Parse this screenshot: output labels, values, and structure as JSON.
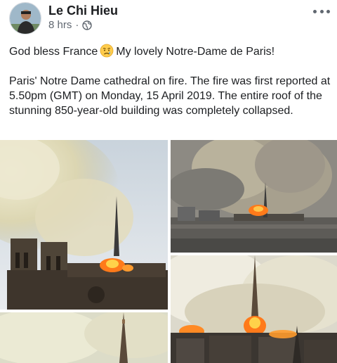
{
  "post": {
    "author": "Le Chi Hieu",
    "time": "8 hrs",
    "separator": "·",
    "privacy_icon": "globe-icon",
    "options_icon": "more-options-icon",
    "line1_before": "God bless France",
    "line1_emoji": "crying-face-emoji",
    "line1_after": "My lovely Notre-Dame de Paris!",
    "paragraph2": "Paris' Notre Dame cathedral on fire. The fire was first reported at 5.50pm (GMT) on Monday, 15 April 2019. The entire roof of the stunning 850-year-old building was completely collapsed."
  },
  "photos": [
    {
      "subject": "Notre-Dame towers and spire with smoke"
    },
    {
      "subject": "Aerial view of Paris with smoke plume"
    },
    {
      "subject": "Burning spire close-up"
    },
    {
      "subject": "Spire in smoke"
    }
  ],
  "colors": {
    "text": "#1c1e21",
    "secondary": "#606770",
    "smoke": "#e6e2cf",
    "fire": "#ff7a1a"
  }
}
